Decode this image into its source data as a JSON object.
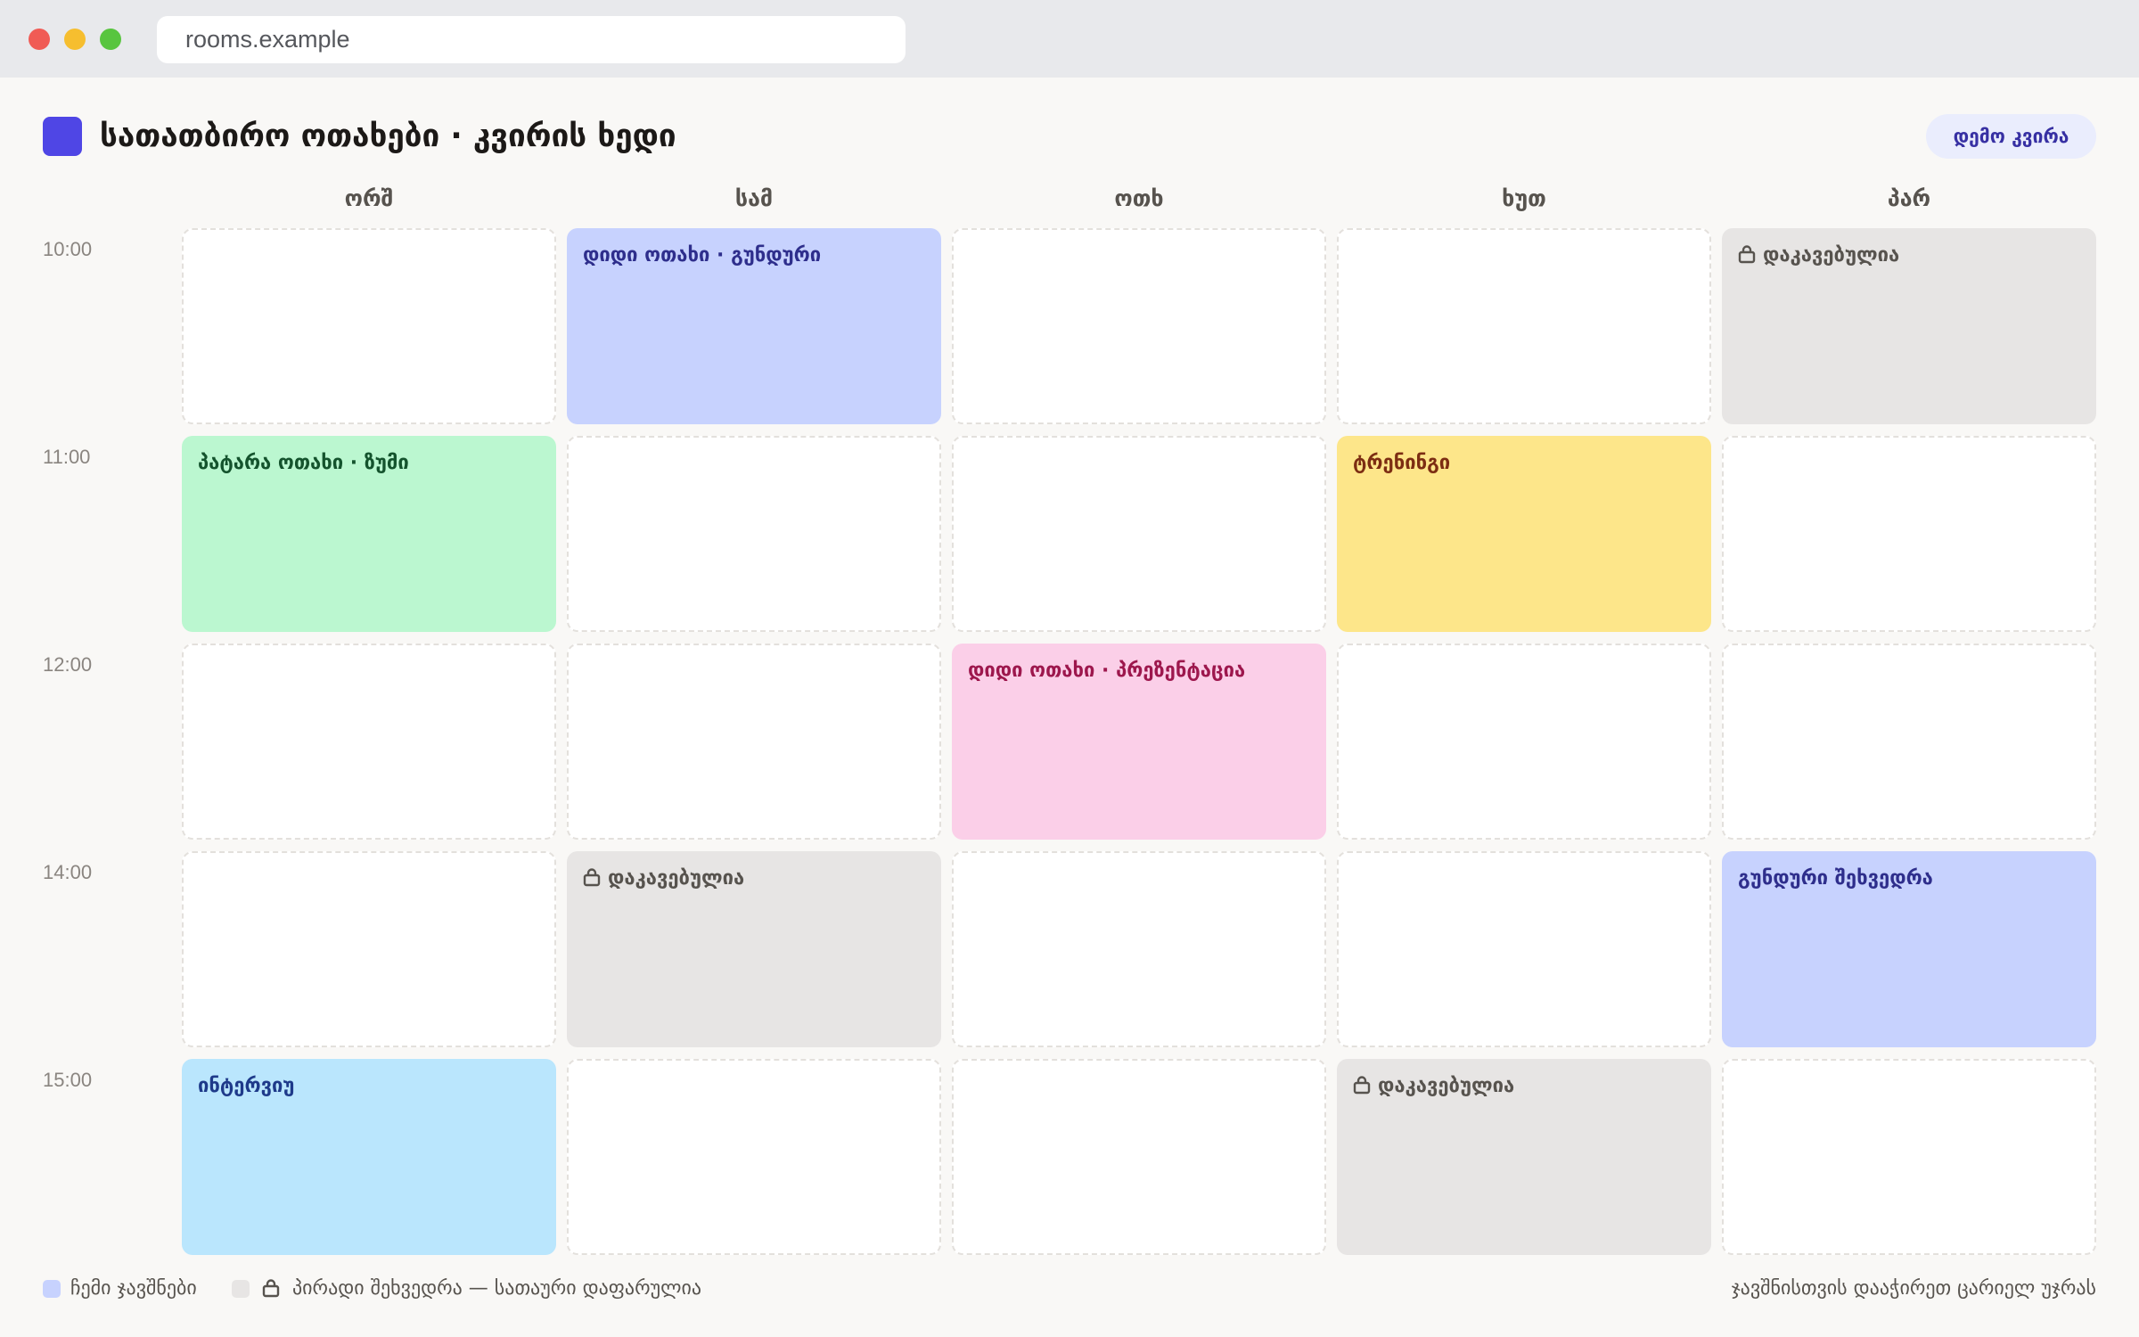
{
  "browser": {
    "url": "rooms.example"
  },
  "header": {
    "title": "სათათბირო ოთახები · კვირის ხედი",
    "demo_button": "დემო კვირა"
  },
  "days": [
    "ორშ",
    "სამ",
    "ოთხ",
    "ხუთ",
    "პარ"
  ],
  "times": [
    "10:00",
    "11:00",
    "12:00",
    "14:00",
    "15:00"
  ],
  "events": {
    "tue_1000": "დიდი ოთახი · გუნდური",
    "fri_1000": "დაკავებულია",
    "mon_1100": "პატარა ოთახი · ზუმი",
    "thu_1100": "ტრენინგი",
    "wed_1200": "დიდი ოთახი · პრეზენტაცია",
    "tue_1400": "დაკავებულია",
    "fri_1400": "გუნდური შეხვედრა",
    "mon_1500": "ინტერვიუ",
    "thu_1500": "დაკავებულია"
  },
  "legend": {
    "my_bookings": "ჩემი ჯავშნები",
    "private": "პირადი შეხვედრა — სათაური დაფარულია",
    "hint": "ჯავშნისთვის დააჭირეთ ცარიელ უჯრას"
  },
  "colors": {
    "brand": "#4f46e5",
    "mine": "#c7d2fe",
    "private": "#e7e5e4"
  },
  "icons": {
    "private": "lock-icon"
  }
}
